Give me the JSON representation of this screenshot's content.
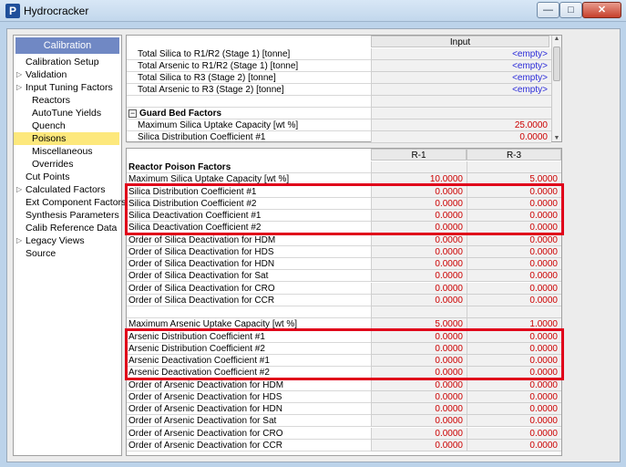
{
  "window": {
    "title": "Hydrocracker",
    "app_icon": "P"
  },
  "sidebar": {
    "header": "Calibration",
    "items": [
      {
        "label": "Calibration Setup",
        "level": 0,
        "tri": false
      },
      {
        "label": "Validation",
        "level": 0,
        "tri": true
      },
      {
        "label": "Input Tuning Factors",
        "level": 0,
        "tri": true
      },
      {
        "label": "Reactors",
        "level": 1,
        "tri": false
      },
      {
        "label": "AutoTune Yields",
        "level": 1,
        "tri": false
      },
      {
        "label": "Quench",
        "level": 1,
        "tri": false
      },
      {
        "label": "Poisons",
        "level": 1,
        "tri": false,
        "selected": true
      },
      {
        "label": "Miscellaneous",
        "level": 1,
        "tri": false
      },
      {
        "label": "Overrides",
        "level": 1,
        "tri": false
      },
      {
        "label": "Cut Points",
        "level": 0,
        "tri": false
      },
      {
        "label": "Calculated Factors",
        "level": 0,
        "tri": true
      },
      {
        "label": "Ext Component Factors",
        "level": 0,
        "tri": false
      },
      {
        "label": "Synthesis Parameters",
        "level": 0,
        "tri": false
      },
      {
        "label": "Calib Reference Data",
        "level": 0,
        "tri": false
      },
      {
        "label": "Legacy Views",
        "level": 0,
        "tri": true
      },
      {
        "label": "Source",
        "level": 0,
        "tri": false
      }
    ]
  },
  "top_grid": {
    "column_header": "Input",
    "rows": [
      {
        "label": "Total Silica to R1/R2 (Stage 1) [tonne]",
        "value": "<empty>",
        "kind": "blue"
      },
      {
        "label": "Total Arsenic to R1/R2 (Stage 1) [tonne]",
        "value": "<empty>",
        "kind": "blue"
      },
      {
        "label": "Total Silica to R3 (Stage 2) [tonne]",
        "value": "<empty>",
        "kind": "blue"
      },
      {
        "label": "Total Arsenic to R3 (Stage 2) [tonne]",
        "value": "<empty>",
        "kind": "blue"
      },
      {
        "label": "",
        "value": "",
        "kind": "blank"
      },
      {
        "label": "Guard Bed Factors",
        "value": "",
        "kind": "section"
      },
      {
        "label": "Maximum Silica Uptake Capacity [wt %]",
        "value": "25.0000",
        "kind": "red"
      },
      {
        "label": "Silica Distribution Coefficient #1",
        "value": "0.0000",
        "kind": "red"
      }
    ]
  },
  "bottom_grid": {
    "columns": [
      "R-1",
      "R-3"
    ],
    "rows": [
      {
        "label": "Reactor Poison Factors",
        "v1": "",
        "v2": "",
        "kind": "section"
      },
      {
        "label": "Maximum Silica Uptake Capacity [wt %]",
        "v1": "10.0000",
        "v2": "5.0000"
      },
      {
        "label": "Silica Distribution Coefficient #1",
        "v1": "0.0000",
        "v2": "0.0000"
      },
      {
        "label": "Silica Distribution Coefficient #2",
        "v1": "0.0000",
        "v2": "0.0000"
      },
      {
        "label": "Silica Deactivation Coefficient #1",
        "v1": "0.0000",
        "v2": "0.0000"
      },
      {
        "label": "Silica Deactivation Coefficient #2",
        "v1": "0.0000",
        "v2": "0.0000"
      },
      {
        "label": "Order of Silica Deactivation for HDM",
        "v1": "0.0000",
        "v2": "0.0000"
      },
      {
        "label": "Order of Silica Deactivation for HDS",
        "v1": "0.0000",
        "v2": "0.0000"
      },
      {
        "label": "Order of Silica Deactivation for HDN",
        "v1": "0.0000",
        "v2": "0.0000"
      },
      {
        "label": "Order of Silica Deactivation for Sat",
        "v1": "0.0000",
        "v2": "0.0000"
      },
      {
        "label": "Order of Silica Deactivation for CRO",
        "v1": "0.0000",
        "v2": "0.0000"
      },
      {
        "label": "Order of Silica Deactivation for CCR",
        "v1": "0.0000",
        "v2": "0.0000"
      },
      {
        "label": "",
        "v1": "",
        "v2": "",
        "kind": "blank"
      },
      {
        "label": "Maximum Arsenic Uptake Capacity [wt %]",
        "v1": "5.0000",
        "v2": "1.0000"
      },
      {
        "label": "Arsenic Distribution Coefficient #1",
        "v1": "0.0000",
        "v2": "0.0000"
      },
      {
        "label": "Arsenic Distribution Coefficient #2",
        "v1": "0.0000",
        "v2": "0.0000"
      },
      {
        "label": "Arsenic Deactivation Coefficient #1",
        "v1": "0.0000",
        "v2": "0.0000"
      },
      {
        "label": "Arsenic Deactivation Coefficient #2",
        "v1": "0.0000",
        "v2": "0.0000"
      },
      {
        "label": "Order of Arsenic Deactivation for HDM",
        "v1": "0.0000",
        "v2": "0.0000"
      },
      {
        "label": "Order of Arsenic Deactivation for HDS",
        "v1": "0.0000",
        "v2": "0.0000"
      },
      {
        "label": "Order of Arsenic Deactivation for HDN",
        "v1": "0.0000",
        "v2": "0.0000"
      },
      {
        "label": "Order of Arsenic Deactivation for Sat",
        "v1": "0.0000",
        "v2": "0.0000"
      },
      {
        "label": "Order of Arsenic Deactivation for CRO",
        "v1": "0.0000",
        "v2": "0.0000"
      },
      {
        "label": "Order of Arsenic Deactivation for CCR",
        "v1": "0.0000",
        "v2": "0.0000"
      }
    ]
  },
  "colors": {
    "value_red": "#cc0000",
    "value_blue": "#2a2ad8",
    "highlight": "#e0001a",
    "selected_item": "#fde87c",
    "sidebar_header": "#7088c4"
  }
}
